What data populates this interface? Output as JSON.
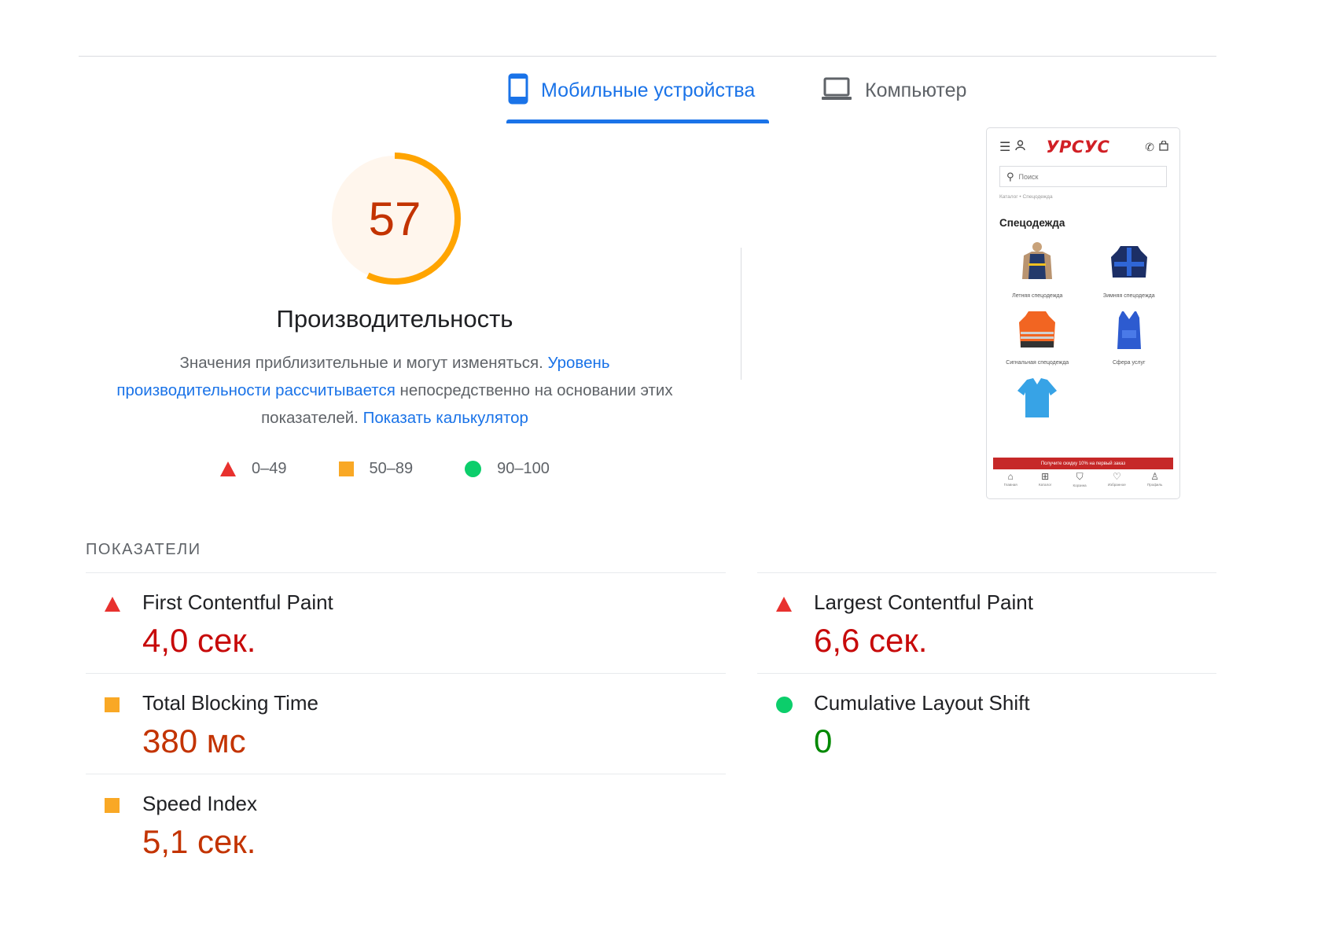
{
  "tabs": [
    {
      "label": "Мобильные устройства",
      "active": true,
      "icon": "smartphone-icon"
    },
    {
      "label": "Компьютер",
      "active": false,
      "icon": "laptop-icon"
    }
  ],
  "performance": {
    "score": "57",
    "score_fraction": 0.57,
    "title": "Производительность",
    "desc_text_1": "Значения приблизительные и могут изменяться. ",
    "desc_link_1": "Уровень производительности рассчитывается",
    "desc_text_2": " непосредственно на основании этих показателей. ",
    "desc_link_2": "Показать калькулятор",
    "colors": {
      "gauge_stroke": "#ffa400",
      "gauge_fill": "#fff6ed",
      "score_text": "#c33300"
    }
  },
  "legend": [
    {
      "shape": "triangle",
      "label": "0–49",
      "color": "#e8312e"
    },
    {
      "shape": "square",
      "label": "50–89",
      "color": "#f9a825"
    },
    {
      "shape": "circle",
      "label": "90–100",
      "color": "#0cce6b"
    }
  ],
  "screenshot": {
    "logo": "УРСУС",
    "search_placeholder": "Поиск",
    "breadcrumb": "Каталог • Спецодежда",
    "heading": "Спецодежда",
    "items": [
      {
        "caption": "Летняя спецодежда"
      },
      {
        "caption": "Зимняя спецодежда"
      },
      {
        "caption": "Сигнальная спецодежда"
      },
      {
        "caption": "Сфера услуг"
      },
      {
        "caption": ""
      }
    ],
    "banner": "Получите скидку 10% на первый заказ",
    "nav": [
      "Главная",
      "Каталог",
      "Корзина",
      "Избранное",
      "Профиль"
    ]
  },
  "metrics": {
    "heading": "ПОКАЗАТЕЛИ",
    "fcp": {
      "name": "First Contentful Paint",
      "value": "4,0 сек.",
      "rating": "poor"
    },
    "lcp": {
      "name": "Largest Contentful Paint",
      "value": "6,6 сек.",
      "rating": "poor"
    },
    "tbt": {
      "name": "Total Blocking Time",
      "value": "380 мс",
      "rating": "average"
    },
    "cls": {
      "name": "Cumulative Layout Shift",
      "value": "0",
      "rating": "good"
    },
    "si": {
      "name": "Speed Index",
      "value": "5,1 сек.",
      "rating": "average"
    }
  }
}
